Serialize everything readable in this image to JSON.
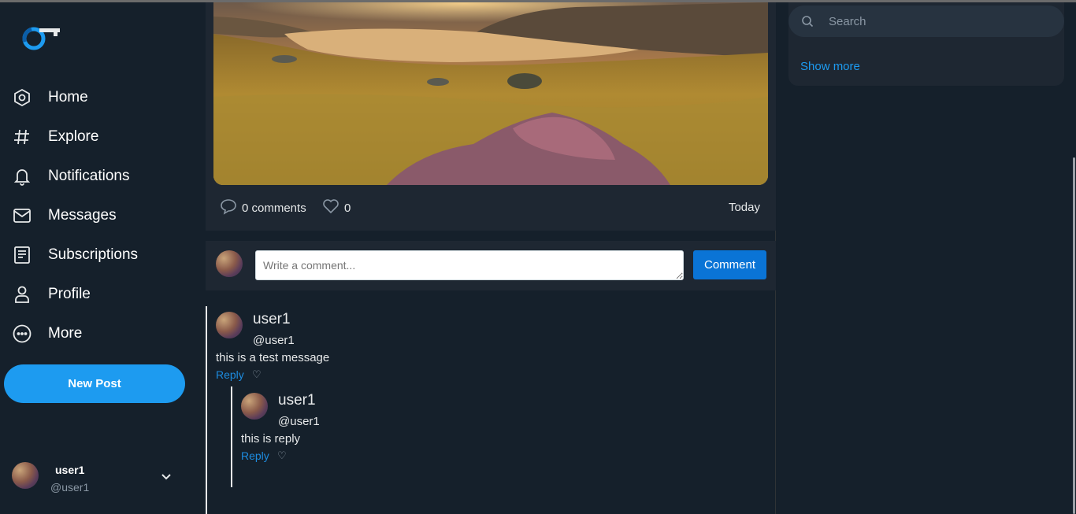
{
  "sidebar": {
    "items": [
      {
        "label": "Home",
        "icon": "home-icon"
      },
      {
        "label": "Explore",
        "icon": "hash-icon"
      },
      {
        "label": "Notifications",
        "icon": "bell-icon"
      },
      {
        "label": "Messages",
        "icon": "mail-icon"
      },
      {
        "label": "Subscriptions",
        "icon": "list-icon"
      },
      {
        "label": "Profile",
        "icon": "user-icon"
      },
      {
        "label": "More",
        "icon": "more-icon"
      }
    ],
    "new_post_label": "New Post",
    "account": {
      "name": "user1",
      "handle": "@user1"
    }
  },
  "post": {
    "comments_label": "0 comments",
    "likes": "0",
    "date": "Today"
  },
  "composer": {
    "placeholder": "Write a comment...",
    "button_label": "Comment"
  },
  "comments": [
    {
      "name": "user1",
      "handle": "@user1",
      "text": "this is a test message",
      "reply_label": "Reply",
      "replies": [
        {
          "name": "user1",
          "handle": "@user1",
          "text": "this is reply",
          "reply_label": "Reply"
        }
      ]
    }
  ],
  "right": {
    "search_placeholder": "Search",
    "show_more_label": "Show more"
  },
  "colors": {
    "background": "#15202b",
    "card": "#1e2732",
    "accent": "#1d9bf0",
    "comment_button": "#0a74d6"
  }
}
